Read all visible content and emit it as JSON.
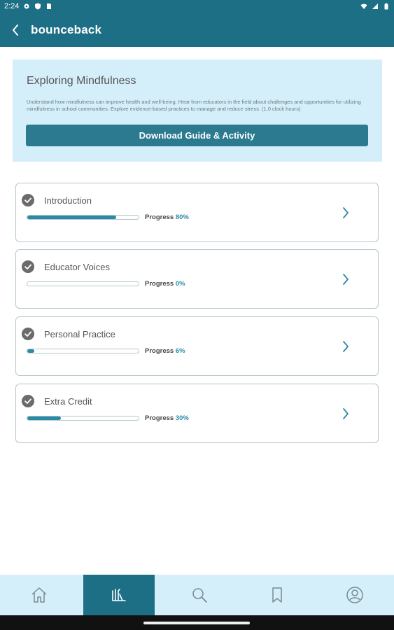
{
  "status_bar": {
    "time": "2:24"
  },
  "app_bar": {
    "brand": "bounceback"
  },
  "course": {
    "title": "Exploring Mindfulness",
    "description": "Understand how mindfulness can improve health and well-being. Hear from educators in the field about challenges and opportunities for utilizing mindfulness in school communities. Explore evidence-based practices to manage and reduce stress. (1.0 clock hours)",
    "download_label": "Download Guide & Activity"
  },
  "modules": [
    {
      "name": "Introduction",
      "progress_label": "Progress",
      "progress_value": "80%",
      "progress": 0.8
    },
    {
      "name": "Educator Voices",
      "progress_label": "Progress",
      "progress_value": "0%",
      "progress": 0.0
    },
    {
      "name": "Personal Practice",
      "progress_label": "Progress",
      "progress_value": "6%",
      "progress": 0.06
    },
    {
      "name": "Extra Credit",
      "progress_label": "Progress",
      "progress_value": "30%",
      "progress": 0.3
    }
  ],
  "bottom_nav": {
    "items": [
      {
        "icon": "home-icon",
        "active": false
      },
      {
        "icon": "library-icon",
        "active": true
      },
      {
        "icon": "search-icon",
        "active": false
      },
      {
        "icon": "bookmark-icon",
        "active": false
      },
      {
        "icon": "profile-icon",
        "active": false
      }
    ]
  },
  "colors": {
    "primary": "#1d6f86",
    "accent": "#2a8aa5",
    "card_bg": "#d4effa"
  }
}
